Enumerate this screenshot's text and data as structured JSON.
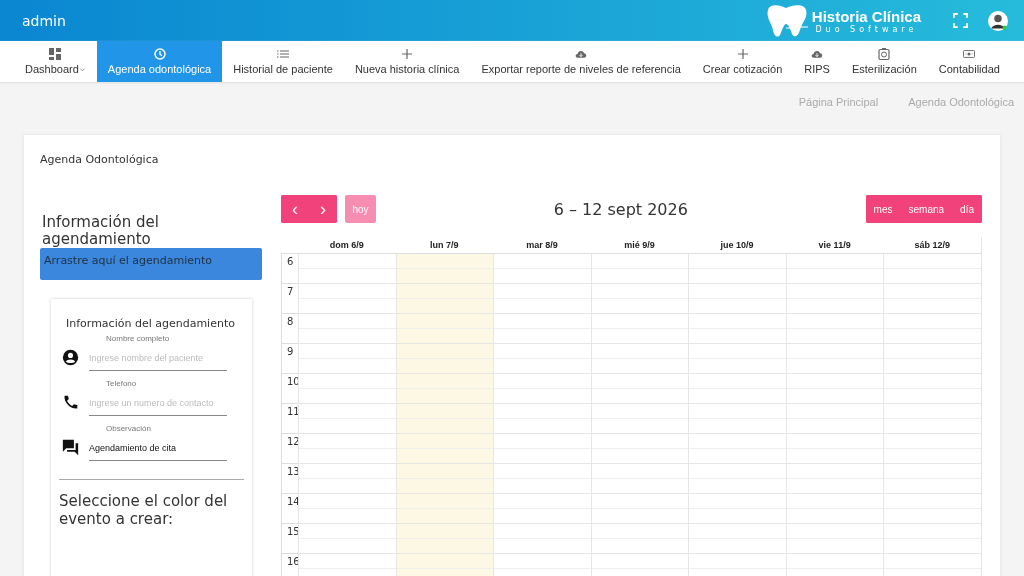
{
  "header": {
    "user": "admin",
    "logo_title": "Historia Clínica",
    "logo_subtitle": "Duo Software"
  },
  "nav": [
    {
      "label": "Dashboard",
      "dropdown": true,
      "selected": false
    },
    {
      "label": "Agenda odontológica",
      "dropdown": false,
      "selected": true
    },
    {
      "label": "Historial de paciente",
      "dropdown": false,
      "selected": false
    },
    {
      "label": "Nueva historia clínica",
      "dropdown": false,
      "selected": false
    },
    {
      "label": "Exportar reporte de niveles de referencia",
      "dropdown": false,
      "selected": false
    },
    {
      "label": "Crear cotización",
      "dropdown": false,
      "selected": false
    },
    {
      "label": "RIPS",
      "dropdown": false,
      "selected": false
    },
    {
      "label": "Esterilización",
      "dropdown": false,
      "selected": false
    },
    {
      "label": "Contabilidad",
      "dropdown": false,
      "selected": false
    }
  ],
  "breadcrumb": [
    "Página Principal",
    "Agenda Odontológica"
  ],
  "card_title": "Agenda Odontológica",
  "side": {
    "heading": "Información del agendamiento",
    "drop_zone": "Arrastre aquí el agendamiento",
    "form_title": "Información del agendamiento",
    "fields": [
      {
        "label": "Nombre completo",
        "placeholder": "Ingrese nombre del paciente"
      },
      {
        "label": "Telefono",
        "placeholder": "Ingrese un numero de contacto"
      },
      {
        "label": "Observación",
        "value": "Agendamiento de cita"
      }
    ],
    "color_heading": "Seleccione el color del evento a crear:"
  },
  "calendar": {
    "prev": "‹",
    "next": "›",
    "today_button": {
      "label": "hoy",
      "disabled": true
    },
    "title": "6 – 12 sept 2026",
    "views": [
      "mes",
      "semana",
      "día"
    ],
    "days": [
      {
        "label": "dom 6/9",
        "today": false
      },
      {
        "label": "lun 7/9",
        "today": true
      },
      {
        "label": "mar 8/9",
        "today": false
      },
      {
        "label": "mié 9/9",
        "today": false
      },
      {
        "label": "jue 10/9",
        "today": false
      },
      {
        "label": "vie 11/9",
        "today": false
      },
      {
        "label": "sáb 12/9",
        "today": false
      }
    ],
    "hours": [
      "6",
      "7",
      "8",
      "9",
      "10",
      "11",
      "12",
      "13",
      "14",
      "15",
      "16"
    ]
  }
}
